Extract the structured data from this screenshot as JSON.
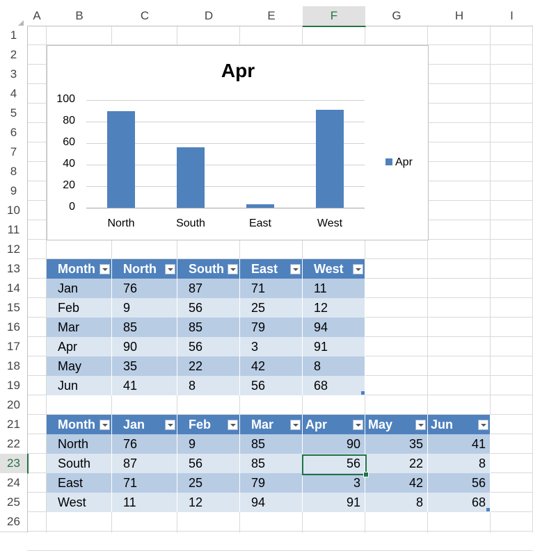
{
  "columns": [
    "A",
    "B",
    "C",
    "D",
    "E",
    "F",
    "G",
    "H",
    "I"
  ],
  "rows": [
    "1",
    "2",
    "3",
    "4",
    "5",
    "6",
    "7",
    "8",
    "9",
    "10",
    "11",
    "12",
    "13",
    "14",
    "15",
    "16",
    "17",
    "18",
    "19",
    "20",
    "21",
    "22",
    "23",
    "24",
    "25",
    "26"
  ],
  "selected_column": "F",
  "selected_row": "23",
  "chart_data": {
    "type": "bar",
    "title": "Apr",
    "categories": [
      "North",
      "South",
      "East",
      "West"
    ],
    "series": [
      {
        "name": "Apr",
        "values": [
          90,
          56,
          3,
          91
        ]
      }
    ],
    "ylim": [
      0,
      100
    ],
    "yticks": [
      "100",
      "80",
      "60",
      "40",
      "20",
      "0"
    ],
    "legend": "right",
    "grid": true,
    "color": "#4f81bd"
  },
  "table1": {
    "headers": [
      "Month",
      "North",
      "South",
      "East",
      "West"
    ],
    "rows": [
      [
        "Jan",
        "76",
        "87",
        "71",
        "11"
      ],
      [
        "Feb",
        "9",
        "56",
        "25",
        "12"
      ],
      [
        "Mar",
        "85",
        "85",
        "79",
        "94"
      ],
      [
        "Apr",
        "90",
        "56",
        "3",
        "91"
      ],
      [
        "May",
        "35",
        "22",
        "42",
        "8"
      ],
      [
        "Jun",
        "41",
        "8",
        "56",
        "68"
      ]
    ]
  },
  "table2": {
    "headers": [
      "Month",
      "Jan",
      "Feb",
      "Mar",
      "Apr",
      "May",
      "Jun"
    ],
    "rows": [
      [
        "North",
        "76",
        "9",
        "85",
        "90",
        "35",
        "41"
      ],
      [
        "South",
        "87",
        "56",
        "85",
        "56",
        "22",
        "8"
      ],
      [
        "East",
        "71",
        "25",
        "79",
        "3",
        "42",
        "56"
      ],
      [
        "West",
        "11",
        "12",
        "94",
        "91",
        "8",
        "68"
      ]
    ]
  },
  "colors": {
    "header": "#4f81bd",
    "band_dark": "#b8cce4",
    "band_light": "#dce6f1",
    "selection": "#217346"
  }
}
